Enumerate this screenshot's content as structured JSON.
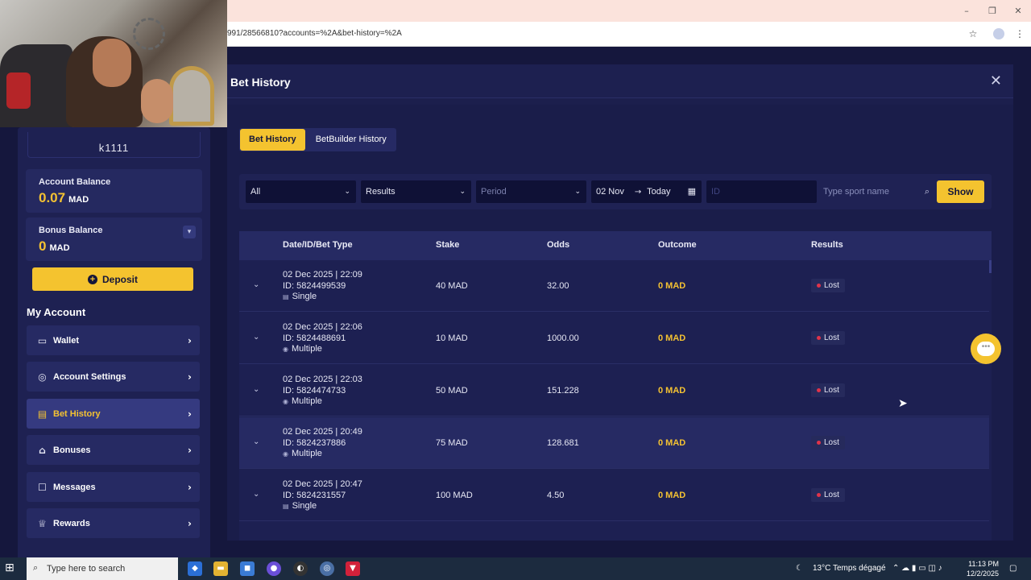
{
  "browser": {
    "url": "991/28566810?accounts=%2A&bet-history=%2A",
    "minimize": "–",
    "restore": "❐",
    "close": "✕",
    "bookmark_icon": "☆",
    "menu_icon": "⋮"
  },
  "sidebar": {
    "username": "k1111",
    "account_balance": {
      "label": "Account Balance",
      "value": "0.07",
      "unit": "MAD"
    },
    "bonus_balance": {
      "label": "Bonus Balance",
      "value": "0",
      "unit": "MAD"
    },
    "deposit_label": "Deposit",
    "section_title": "My Account",
    "items": [
      {
        "label": "Wallet",
        "icon": "▭"
      },
      {
        "label": "Account Settings",
        "icon": "◎"
      },
      {
        "label": "Bet History",
        "icon": "▤"
      },
      {
        "label": "Bonuses",
        "icon": "⌂"
      },
      {
        "label": "Messages",
        "icon": "☐"
      },
      {
        "label": "Rewards",
        "icon": "♕"
      }
    ]
  },
  "modal": {
    "title": "Bet History",
    "close": "✕",
    "tabs": [
      {
        "label": "Bet History",
        "active": true
      },
      {
        "label": "BetBuilder History",
        "active": false
      }
    ],
    "filters": {
      "type": "All",
      "results": "Results",
      "period": "Period",
      "date_from": "02 Nov",
      "date_sep": "→",
      "date_to": "Today",
      "id_placeholder": "ID",
      "sport_placeholder": "Type sport name",
      "show_label": "Show"
    },
    "table": {
      "headers": [
        "Date/ID/Bet Type",
        "Stake",
        "Odds",
        "Outcome",
        "Results"
      ],
      "rows": [
        {
          "date": "02 Dec 2025 | 22:09",
          "id": "ID: 5824499539",
          "type": "Single",
          "stake": "40 MAD",
          "odds": "32.00",
          "outcome": "0 MAD",
          "result": "Lost"
        },
        {
          "date": "02 Dec 2025 | 22:06",
          "id": "ID: 5824488691",
          "type": "Multiple",
          "stake": "10 MAD",
          "odds": "1000.00",
          "outcome": "0 MAD",
          "result": "Lost"
        },
        {
          "date": "02 Dec 2025 | 22:03",
          "id": "ID: 5824474733",
          "type": "Multiple",
          "stake": "50 MAD",
          "odds": "151.228",
          "outcome": "0 MAD",
          "result": "Lost"
        },
        {
          "date": "02 Dec 2025 | 20:49",
          "id": "ID: 5824237886",
          "type": "Multiple",
          "stake": "75 MAD",
          "odds": "128.681",
          "outcome": "0 MAD",
          "result": "Lost"
        },
        {
          "date": "02 Dec 2025 | 20:47",
          "id": "ID: 5824231557",
          "type": "Single",
          "stake": "100 MAD",
          "odds": "4.50",
          "outcome": "0 MAD",
          "result": "Lost"
        }
      ]
    }
  },
  "taskbar": {
    "search_placeholder": "Type here to search",
    "weather": "13°C  Temps dégagé",
    "time": "11:13 PM",
    "date": "12/2/2025"
  },
  "colors": {
    "accent": "#f4c32f",
    "bg": "#14163a",
    "panel": "#1e2152",
    "lost_dot": "#e0334a"
  }
}
